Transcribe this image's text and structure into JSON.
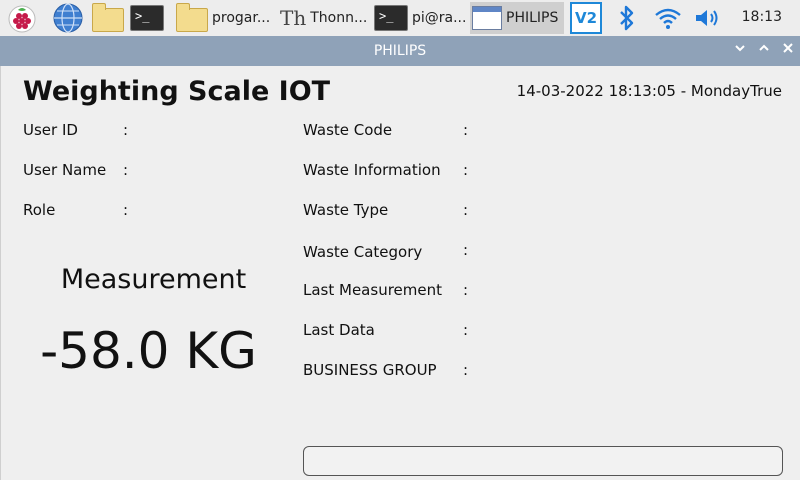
{
  "taskbar": {
    "menu_icon": "raspberry-menu-icon",
    "browser_icon": "globe-icon",
    "filemanager_icon": "folder-icon",
    "terminal_icon": "terminal-icon",
    "tasks": [
      {
        "label": "progar...",
        "icon": "folder-icon"
      },
      {
        "label": "Thonn...",
        "icon": "thonny-icon"
      },
      {
        "label": "pi@ra...",
        "icon": "terminal-icon"
      },
      {
        "label": "PHILIPS",
        "icon": "window-icon",
        "active": true
      }
    ],
    "tray": [
      "vnc-icon",
      "bluetooth-icon",
      "wifi-icon",
      "volume-icon"
    ],
    "vnc_text": "V2",
    "clock": "18:13"
  },
  "window": {
    "title": "PHILIPS",
    "controls": [
      "minimize",
      "maximize",
      "close"
    ]
  },
  "app": {
    "title": "Weighting Scale IOT",
    "datetime": "14-03-2022 18:13:05 - MondayTrue",
    "left_fields": [
      {
        "label": "User ID",
        "value": ""
      },
      {
        "label": "User Name",
        "value": ""
      },
      {
        "label": "Role",
        "value": ""
      }
    ],
    "right_fields": [
      {
        "label": "Waste Code",
        "value": ""
      },
      {
        "label": "Waste Information",
        "value": ""
      },
      {
        "label": "Waste Type",
        "value": ""
      },
      {
        "label": "Waste Category",
        "value": ""
      },
      {
        "label": "Last Measurement",
        "value": ""
      },
      {
        "label": "Last Data",
        "value": ""
      },
      {
        "label": "BUSINESS GROUP",
        "value": ""
      }
    ],
    "separator": ":",
    "measurement_title": "Measurement",
    "measurement_value": "-58.0 KG",
    "status_text": ""
  },
  "colors": {
    "taskbar_bg": "#ededed",
    "titlebar_bg": "#8fa2b8",
    "content_bg": "#efefef",
    "accent_blue": "#1e78d8"
  }
}
